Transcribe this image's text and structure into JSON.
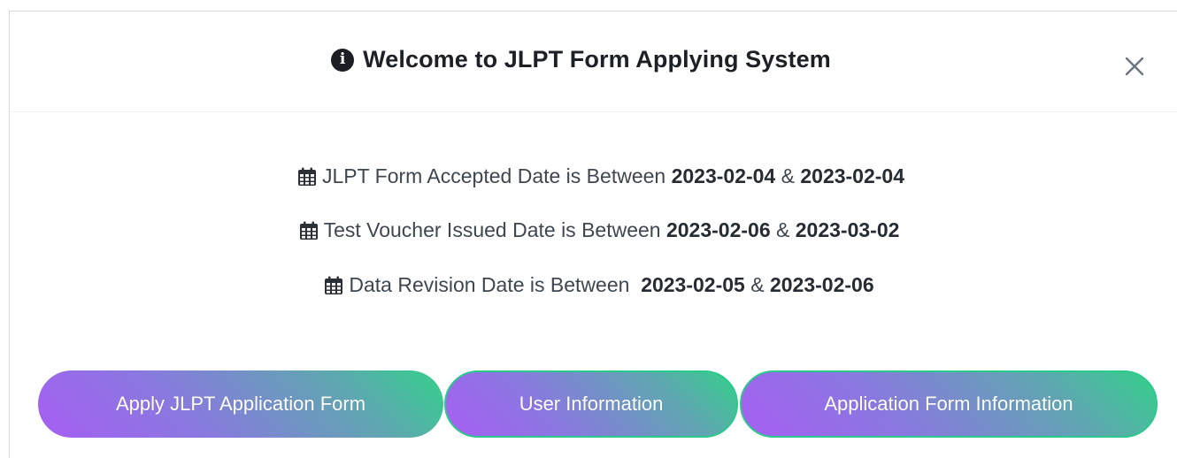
{
  "modal": {
    "title": "Welcome to JLPT Form Applying System",
    "title_icon": "info-circle-icon",
    "close_icon": "close-icon"
  },
  "dates": [
    {
      "label": "JLPT Form Accepted Date is Between ",
      "start": "2023-02-04",
      "sep": " & ",
      "end": "2023-02-04",
      "icon": "calendar-icon"
    },
    {
      "label": "Test Voucher Issued Date is Between ",
      "start": "2023-02-06",
      "sep": " & ",
      "end": "2023-03-02",
      "icon": "calendar-icon"
    },
    {
      "label": "Data Revision Date is Between  ",
      "start": "2023-02-05",
      "sep": " & ",
      "end": "2023-02-06",
      "icon": "calendar-icon"
    }
  ],
  "buttons": {
    "apply": "Apply JLPT Application Form",
    "user_info": "User Information",
    "app_form_info": "Application Form Information"
  },
  "colors": {
    "gradient_start": "#a75ef3",
    "gradient_end": "#34d08a",
    "button_border": "#2ac98c"
  }
}
